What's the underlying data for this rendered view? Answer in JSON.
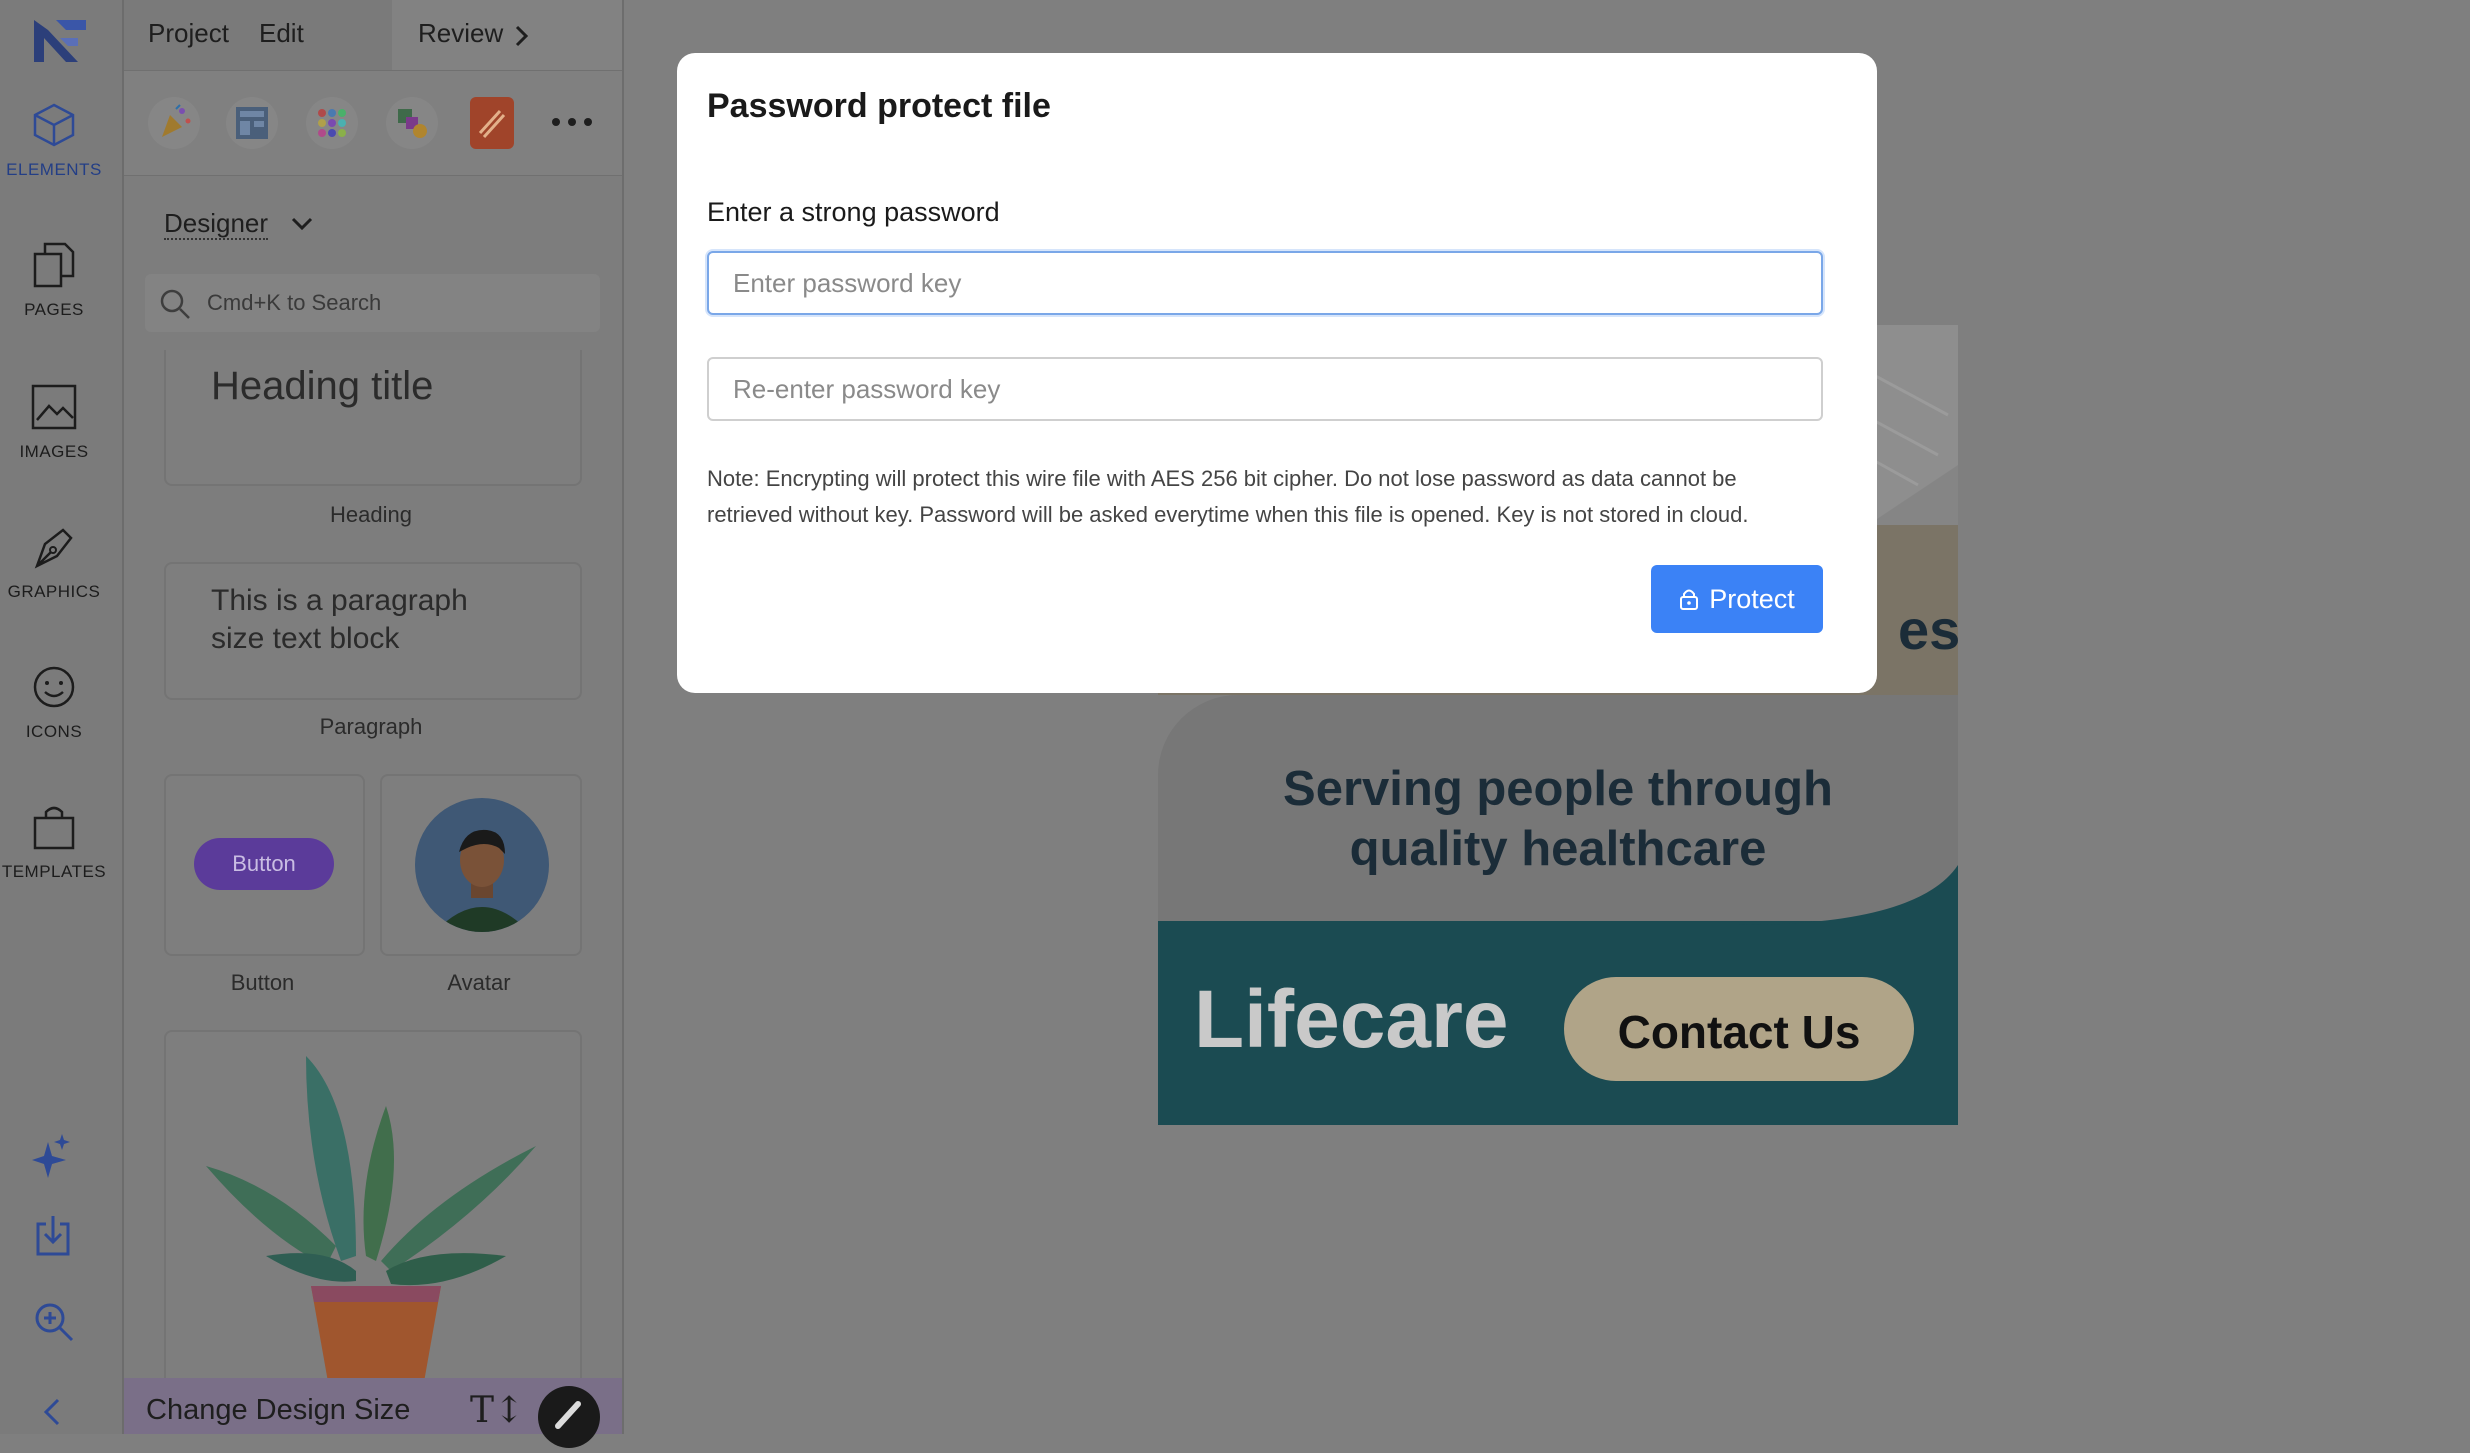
{
  "menubar": {
    "project": "Project",
    "edit": "Edit",
    "review": "Review"
  },
  "rail": {
    "items": [
      {
        "label": "ELEMENTS",
        "icon": "cube-icon"
      },
      {
        "label": "PAGES",
        "icon": "pages-icon"
      },
      {
        "label": "IMAGES",
        "icon": "image-icon"
      },
      {
        "label": "GRAPHICS",
        "icon": "pen-nib-icon"
      },
      {
        "label": "ICONS",
        "icon": "smiley-icon"
      },
      {
        "label": "TEMPLATES",
        "icon": "bag-icon"
      }
    ],
    "bottom_icons": [
      "sparkle-icon",
      "download-icon",
      "zoom-in-icon",
      "chevron-left-icon"
    ]
  },
  "panel": {
    "dropdown_value": "Designer",
    "search_placeholder": "Cmd+K to Search",
    "heading_sample": "Heading title",
    "heading_caption": "Heading",
    "paragraph_sample": "This is a paragraph size text block",
    "paragraph_caption": "Paragraph",
    "button_sample": "Button",
    "button_caption": "Button",
    "avatar_caption": "Avatar",
    "footer_label": "Change Design Size"
  },
  "design": {
    "tagline": "Serving people through quality healthcare",
    "brand": "Lifecare",
    "cta": "Contact Us",
    "partial_text": "es",
    "colors": {
      "teal": "#1b4b52",
      "beige": "#b0a488",
      "light": "#eeeeee"
    }
  },
  "modal": {
    "title": "Password protect file",
    "label": "Enter a strong password",
    "password_placeholder": "Enter password key",
    "reenter_placeholder": "Re-enter password key",
    "note": "Note: Encrypting will protect this wire file with AES 256 bit cipher. Do not lose password as data cannot be retrieved without key. Password will be asked everytime when this file is opened. Key is not stored in cloud.",
    "button_label": "Protect",
    "accent": "#3b82f6"
  }
}
